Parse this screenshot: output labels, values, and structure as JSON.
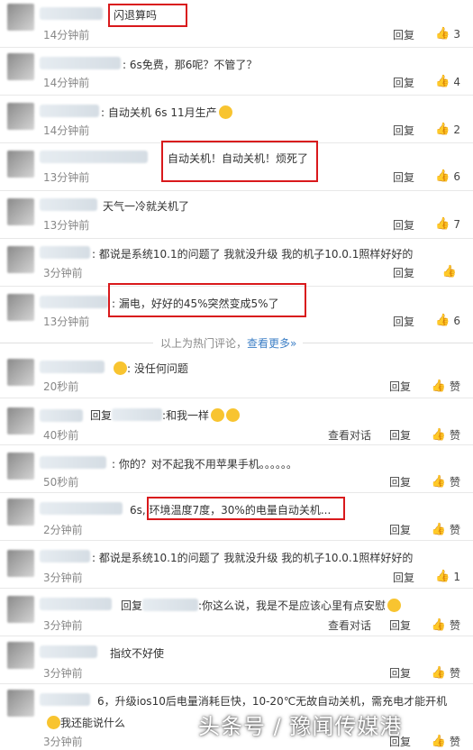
{
  "reply_label": "回复",
  "like_label": "赞",
  "view_dialog_label": "查看对话",
  "comments": [
    {
      "text": "闪退算吗",
      "time": "14分钟前",
      "likes": "3"
    },
    {
      "text": ": 6s免费，那6呢？不管了？",
      "time": "14分钟前",
      "likes": "4"
    },
    {
      "text": ": 自动关机 6s 11月生产",
      "time": "14分钟前",
      "likes": "2"
    },
    {
      "text": "自动关机！自动关机！烦死了",
      "time": "13分钟前",
      "likes": "6"
    },
    {
      "text": "天气一冷就关机了",
      "time": "13分钟前",
      "likes": "7"
    },
    {
      "text": ": 都说是系统10.1的问题了 我就没升级 我的机子10.0.1照样好好的",
      "time": "3分钟前",
      "likes": ""
    },
    {
      "text": ": 漏电，好好的45%突然变成5%了",
      "time": "13分钟前",
      "likes": "6"
    }
  ],
  "divider": {
    "text": "以上为热门评论，",
    "link": "查看更多»"
  },
  "latest": [
    {
      "text": ": 没任何问题",
      "time": "20秒前",
      "likes": "赞"
    },
    {
      "text": "回复",
      "text2": ":和我一样",
      "time": "40秒前",
      "likes": "赞",
      "dialog": true
    },
    {
      "text": ": 你的？对不起我不用苹果手机。。。。。。",
      "time": "50秒前",
      "likes": "赞"
    },
    {
      "text": "6s",
      "text2": ", 环境温度7度，30%的电量自动关机...",
      "time": "2分钟前",
      "likes": "赞"
    },
    {
      "text": ": 都说是系统10.1的问题了 我就没升级 我的机子10.0.1照样好好的",
      "time": "3分钟前",
      "likes": "1"
    },
    {
      "text": "回复",
      "text2": ":你这么说，我是不是应该心里有点安慰",
      "time": "3分钟前",
      "likes": "赞",
      "dialog": true
    },
    {
      "text": "指纹不好使",
      "time": "3分钟前",
      "likes": "赞"
    },
    {
      "text": "6，升级ios10后电量消耗巨快，10-20℃无故自动关机，需充电才能开机",
      "text2": "我还能说什么",
      "time": "3分钟前",
      "likes": "赞"
    }
  ],
  "watermark": "头条号 / 豫闻传媒港"
}
